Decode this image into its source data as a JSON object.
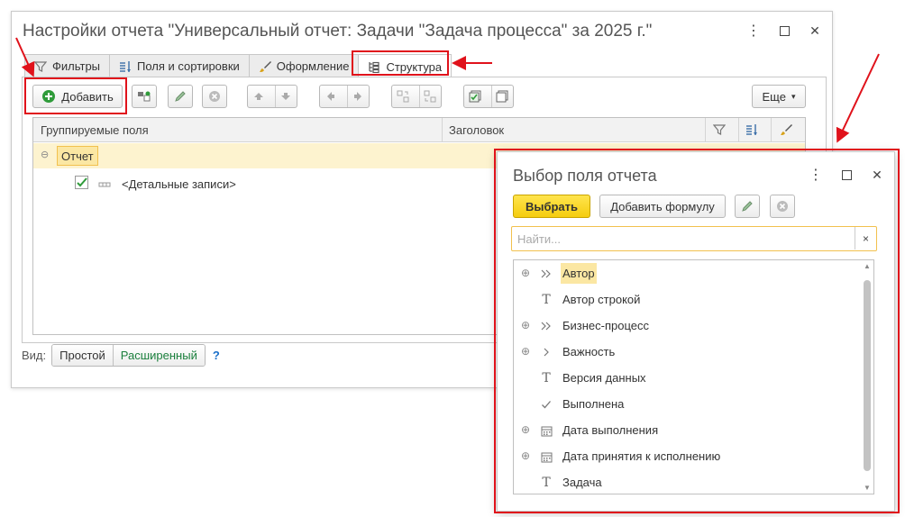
{
  "main_window": {
    "title": "Настройки отчета \"Универсальный отчет: Задачи \"Задача процесса\" за 2025 г.\"",
    "tabs": [
      {
        "label": "Фильтры",
        "icon": "filter-icon"
      },
      {
        "label": "Поля и сортировки",
        "icon": "fields-sort-icon"
      },
      {
        "label": "Оформление",
        "icon": "brush-icon"
      },
      {
        "label": "Структура",
        "icon": "structure-icon",
        "active": true
      }
    ],
    "toolbar": {
      "add_label": "Добавить",
      "more_label": "Еще"
    },
    "grid": {
      "col_group_fields": "Группируемые поля",
      "col_header": "Заголовок",
      "rows": [
        {
          "label": "Отчет",
          "level": 0
        },
        {
          "label": "<Детальные записи>",
          "level": 1,
          "checked": true
        }
      ]
    },
    "view": {
      "label": "Вид:",
      "simple": "Простой",
      "advanced": "Расширенный",
      "help": "?"
    }
  },
  "dialog": {
    "title": "Выбор поля отчета",
    "select_label": "Выбрать",
    "add_formula_label": "Добавить формулу",
    "search_placeholder": "Найти...",
    "search_clear": "×",
    "items": [
      {
        "label": "Автор",
        "icon": "double-chevron-icon",
        "expandable": true,
        "selected": true
      },
      {
        "label": "Автор строкой",
        "icon": "text-type-icon",
        "expandable": false
      },
      {
        "label": "Бизнес-процесс",
        "icon": "double-chevron-icon",
        "expandable": true
      },
      {
        "label": "Важность",
        "icon": "chevron-icon",
        "expandable": true
      },
      {
        "label": "Версия данных",
        "icon": "text-type-icon",
        "expandable": false
      },
      {
        "label": "Выполнена",
        "icon": "checkmark-icon",
        "expandable": false
      },
      {
        "label": "Дата выполнения",
        "icon": "calendar-icon",
        "expandable": true
      },
      {
        "label": "Дата принятия к исполнению",
        "icon": "calendar-icon",
        "expandable": true
      },
      {
        "label": "Задача",
        "icon": "text-type-icon",
        "expandable": false
      }
    ]
  },
  "colors": {
    "highlight_red": "#e0121b",
    "selection_yellow": "#fbe7a3",
    "primary_yellow": "#f5cd0f",
    "link_green": "#1a7f3c",
    "help_blue": "#1a6fc9"
  }
}
